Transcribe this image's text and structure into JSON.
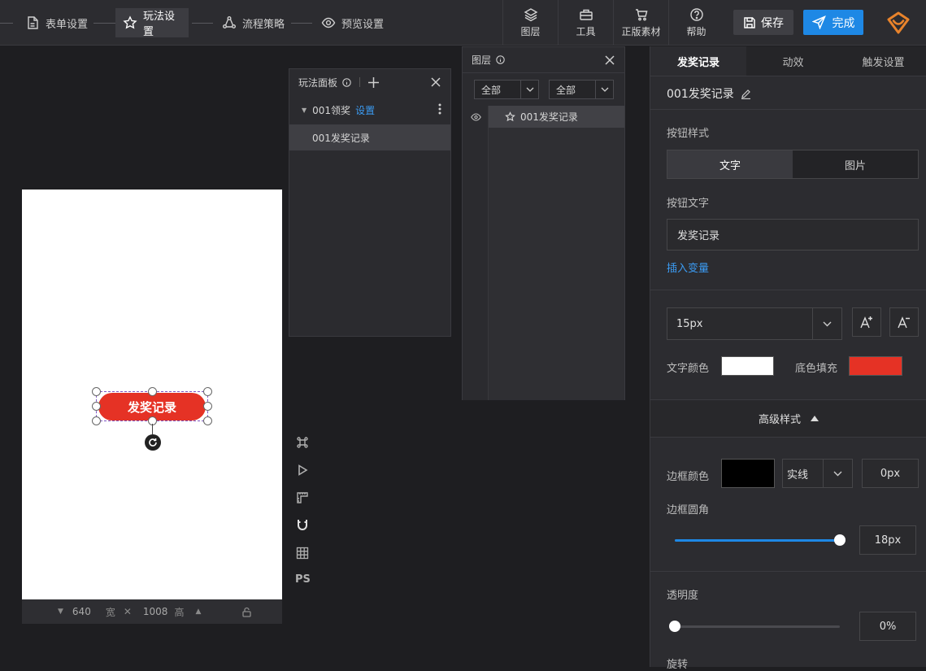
{
  "header": {
    "steps": [
      {
        "label": "表单设置",
        "icon": "document-icon",
        "active": false
      },
      {
        "label": "玩法设置",
        "icon": "star-icon",
        "active": true
      },
      {
        "label": "流程策略",
        "icon": "flow-icon",
        "active": false
      },
      {
        "label": "预览设置",
        "icon": "eye-icon",
        "active": false
      }
    ],
    "tools": [
      {
        "label": "图层",
        "icon": "layers-icon"
      },
      {
        "label": "工具",
        "icon": "toolbox-icon"
      },
      {
        "label": "正版素材",
        "icon": "cart-icon"
      },
      {
        "label": "帮助",
        "icon": "help-icon"
      }
    ],
    "save_label": "保存",
    "done_label": "完成",
    "brand_color": "#e8832b"
  },
  "canvas": {
    "element_text": "发奖记录",
    "element_color": "#e53225",
    "width": "640",
    "width_unit": "宽",
    "height": "1008",
    "height_unit": "高",
    "side_tools": [
      "command-icon",
      "play-icon",
      "ruler-icon",
      "magnet-icon",
      "grid-icon"
    ],
    "ps_label": "PS"
  },
  "play_panel": {
    "title": "玩法面板",
    "group_name": "001领奖",
    "group_link": "设置",
    "item": "001发奖记录"
  },
  "layer_panel": {
    "title": "图层",
    "filter1": "全部",
    "filter2": "全部",
    "layer_item": "001发奖记录"
  },
  "props": {
    "tabs": [
      "发奖记录",
      "动效",
      "触发设置"
    ],
    "element_name": "001发奖记录",
    "btn_style_label": "按钮样式",
    "style_options": [
      "文字",
      "图片"
    ],
    "btn_text_label": "按钮文字",
    "btn_text_value": "发奖记录",
    "insert_var": "插入变量",
    "font_size": "15px",
    "text_color_label": "文字颜色",
    "text_color": "#ffffff",
    "fill_label": "底色填充",
    "fill_color": "#e53225",
    "advanced_label": "高级样式",
    "border_color_label": "边框颜色",
    "border_color": "#000000",
    "border_style": "实线",
    "border_width": "0px",
    "radius_label": "边框圆角",
    "radius_value": "18px",
    "radius_fraction": 1.0,
    "opacity_label": "透明度",
    "opacity_value": "0%",
    "opacity_fraction": 0.0,
    "rotate_label": "旋转"
  }
}
